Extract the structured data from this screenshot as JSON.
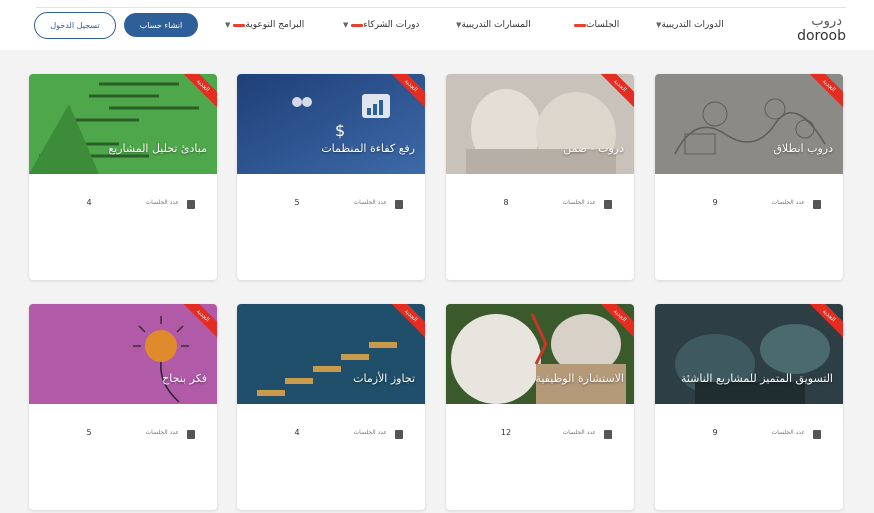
{
  "header": {
    "logo_ar": "دروب",
    "logo_en": "doroob",
    "nav": {
      "courses": "الدورات التدريبية",
      "sessions": "الجلسات",
      "paths": "المسارات التدريبية",
      "partners": "دورات الشركاء",
      "awareness": "البرامج التوعوية"
    },
    "register_label": "انشاء حساب",
    "login_label": "تسجيل الدخول"
  },
  "badge_label": "الجديد",
  "meta_label": "عدد الجلسات",
  "colors": {
    "primary": "#2f5f98",
    "ribbon": "#e42c21",
    "new_marker": "#e7412f"
  },
  "cards": [
    {
      "title": "دروب انطلاق",
      "count": "9"
    },
    {
      "title": "دروب - ضمن",
      "count": "8"
    },
    {
      "title": "رفع كفاءة المنظمات",
      "count": "5"
    },
    {
      "title": "مبادئ تحليل المشاريع",
      "count": "4"
    },
    {
      "title": "التسويق المتميز للمشاريع الناشئة",
      "count": "9"
    },
    {
      "title": "الاستشارة الوظيفية",
      "count": "12"
    },
    {
      "title": "تجاوز الأزمات",
      "count": "4"
    },
    {
      "title": "فكر بنجاح",
      "count": "5"
    }
  ]
}
